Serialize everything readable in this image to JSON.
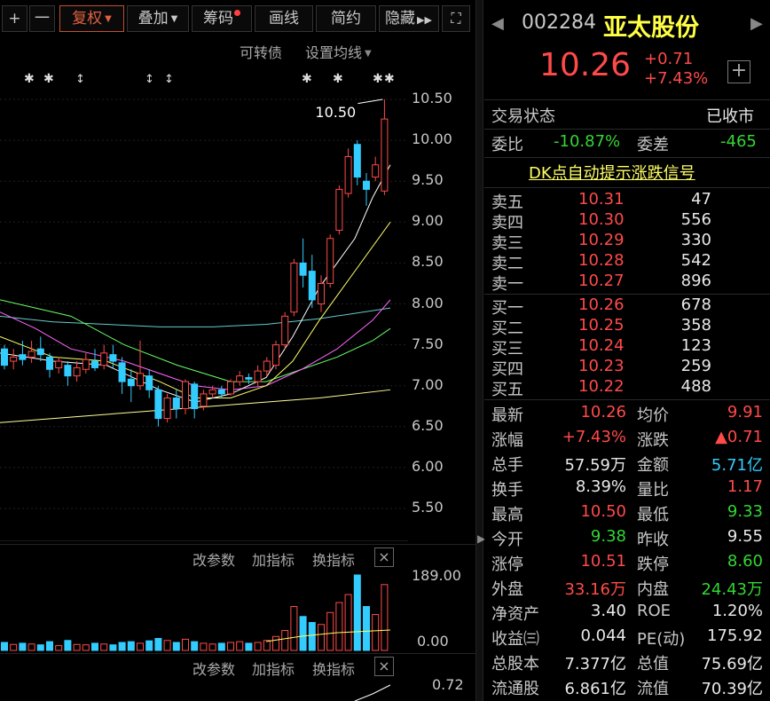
{
  "toolbar": {
    "plus": "+",
    "minus": "一",
    "fuquan": "复权",
    "diejia": "叠加",
    "chouma": "筹码",
    "huaxian": "画线",
    "jianyue": "简约",
    "yincang": "隐藏",
    "fullscreen_icon": "⛶"
  },
  "chart_header": {
    "kezhuanzhai": "可转债",
    "shezhi_junxian": "设置均线"
  },
  "price_axis": {
    "ticks": [
      "10.50",
      "10.00",
      "9.50",
      "9.00",
      "8.50",
      "8.00",
      "7.50",
      "7.00",
      "6.50",
      "6.00",
      "5.50"
    ],
    "high_marker": "10.50"
  },
  "volume_panel": {
    "gaicanshu": "改参数",
    "jiazhibiao": "加指标",
    "huanzhibiao": "换指标",
    "close": "×",
    "top_tick": "189.00",
    "bottom_tick": "0.00"
  },
  "indicator_panel": {
    "gaicanshu": "改参数",
    "jiazhibiao": "加指标",
    "huanzhibiao": "换指标",
    "close": "×",
    "top_tick": "0.72"
  },
  "quote": {
    "code": "002284",
    "name": "亚太股份",
    "price": "10.26",
    "change": "+0.71",
    "change_pct": "+7.43%",
    "jiaoyi_label": "交易状态",
    "jiaoyi_value": "已收市",
    "weibi_label": "委比",
    "weibi_value": "-10.87%",
    "weicha_label": "委差",
    "weicha_value": "-465",
    "dk_link": "DK点自动提示涨跌信号"
  },
  "orderbook": {
    "asks": [
      {
        "label": "卖五",
        "price": "10.31",
        "vol": "47"
      },
      {
        "label": "卖四",
        "price": "10.30",
        "vol": "556"
      },
      {
        "label": "卖三",
        "price": "10.29",
        "vol": "330"
      },
      {
        "label": "卖二",
        "price": "10.28",
        "vol": "542"
      },
      {
        "label": "卖一",
        "price": "10.27",
        "vol": "896"
      }
    ],
    "bids": [
      {
        "label": "买一",
        "price": "10.26",
        "vol": "678"
      },
      {
        "label": "买二",
        "price": "10.25",
        "vol": "358"
      },
      {
        "label": "买三",
        "price": "10.24",
        "vol": "123"
      },
      {
        "label": "买四",
        "price": "10.23",
        "vol": "259"
      },
      {
        "label": "买五",
        "price": "10.22",
        "vol": "488"
      }
    ]
  },
  "stats": [
    {
      "l1": "最新",
      "v1": "10.26",
      "c1": "red",
      "l2": "均价",
      "v2": "9.91",
      "c2": "red"
    },
    {
      "l1": "涨幅",
      "v1": "+7.43%",
      "c1": "red",
      "l2": "涨跌",
      "v2": "▲0.71",
      "c2": "red"
    },
    {
      "l1": "总手",
      "v1": "57.59万",
      "c1": "white",
      "l2": "金额",
      "v2": "5.71亿",
      "c2": "cyan"
    },
    {
      "l1": "换手",
      "v1": "8.39%",
      "c1": "white",
      "l2": "量比",
      "v2": "1.17",
      "c2": "red"
    },
    {
      "l1": "最高",
      "v1": "10.50",
      "c1": "red",
      "l2": "最低",
      "v2": "9.33",
      "c2": "green"
    },
    {
      "l1": "今开",
      "v1": "9.38",
      "c1": "green",
      "l2": "昨收",
      "v2": "9.55",
      "c2": "white"
    },
    {
      "l1": "涨停",
      "v1": "10.51",
      "c1": "red",
      "l2": "跌停",
      "v2": "8.60",
      "c2": "green"
    },
    {
      "l1": "外盘",
      "v1": "33.16万",
      "c1": "red",
      "l2": "内盘",
      "v2": "24.43万",
      "c2": "green"
    },
    {
      "l1": "净资产",
      "v1": "3.40",
      "c1": "white",
      "l2": "ROE",
      "v2": "1.20%",
      "c2": "white"
    },
    {
      "l1": "收益㈢",
      "v1": "0.044",
      "c1": "white",
      "l2": "PE(动)",
      "v2": "175.92",
      "c2": "white"
    },
    {
      "l1": "总股本",
      "v1": "7.377亿",
      "c1": "white",
      "l2": "总值",
      "v2": "75.69亿",
      "c2": "white"
    },
    {
      "l1": "流通股",
      "v1": "6.861亿",
      "c1": "white",
      "l2": "流值",
      "v2": "70.39亿",
      "c2": "white"
    }
  ],
  "colors": {
    "up": "#ff4a4a",
    "down": "#33d633",
    "down_candle": "#33ccff",
    "ma5": "#ffffff",
    "ma10": "#ffff66",
    "ma20": "#ff66ff",
    "ma30": "#66ff66",
    "ma60": "#66cccc",
    "ma120": "#ffff99"
  },
  "chart_data": {
    "type": "candlestick",
    "ylim": [
      5.2,
      10.7
    ],
    "candles": [
      {
        "o": 7.45,
        "c": 7.25,
        "h": 7.5,
        "l": 7.2
      },
      {
        "o": 7.3,
        "c": 7.35,
        "h": 7.45,
        "l": 7.2
      },
      {
        "o": 7.38,
        "c": 7.32,
        "h": 7.55,
        "l": 7.25
      },
      {
        "o": 7.35,
        "c": 7.42,
        "h": 7.55,
        "l": 7.28
      },
      {
        "o": 7.45,
        "c": 7.38,
        "h": 7.6,
        "l": 7.3
      },
      {
        "o": 7.35,
        "c": 7.2,
        "h": 7.4,
        "l": 7.1
      },
      {
        "o": 7.22,
        "c": 7.3,
        "h": 7.35,
        "l": 7.15
      },
      {
        "o": 7.25,
        "c": 7.12,
        "h": 7.3,
        "l": 7.0
      },
      {
        "o": 7.12,
        "c": 7.22,
        "h": 7.3,
        "l": 7.05
      },
      {
        "o": 7.2,
        "c": 7.32,
        "h": 7.4,
        "l": 7.15
      },
      {
        "o": 7.3,
        "c": 7.22,
        "h": 7.45,
        "l": 7.18
      },
      {
        "o": 7.25,
        "c": 7.4,
        "h": 7.5,
        "l": 7.2
      },
      {
        "o": 7.38,
        "c": 7.3,
        "h": 7.5,
        "l": 7.22
      },
      {
        "o": 7.28,
        "c": 7.05,
        "h": 7.35,
        "l": 6.9
      },
      {
        "o": 7.08,
        "c": 7.0,
        "h": 7.2,
        "l": 6.8
      },
      {
        "o": 7.0,
        "c": 7.15,
        "h": 7.55,
        "l": 6.95
      },
      {
        "o": 7.12,
        "c": 6.95,
        "h": 7.2,
        "l": 6.85
      },
      {
        "o": 6.95,
        "c": 6.6,
        "h": 7.0,
        "l": 6.5
      },
      {
        "o": 6.6,
        "c": 6.85,
        "h": 6.9,
        "l": 6.55
      },
      {
        "o": 6.85,
        "c": 6.72,
        "h": 6.95,
        "l": 6.6
      },
      {
        "o": 6.72,
        "c": 7.05,
        "h": 7.08,
        "l": 6.65
      },
      {
        "o": 7.02,
        "c": 6.72,
        "h": 7.05,
        "l": 6.6
      },
      {
        "o": 6.75,
        "c": 6.9,
        "h": 6.95,
        "l": 6.7
      },
      {
        "o": 6.9,
        "c": 6.95,
        "h": 7.0,
        "l": 6.85
      },
      {
        "o": 6.95,
        "c": 6.9,
        "h": 7.0,
        "l": 6.85
      },
      {
        "o": 6.9,
        "c": 7.05,
        "h": 7.08,
        "l": 6.88
      },
      {
        "o": 7.05,
        "c": 7.12,
        "h": 7.18,
        "l": 7.0
      },
      {
        "o": 7.1,
        "c": 7.08,
        "h": 7.15,
        "l": 7.02
      },
      {
        "o": 7.05,
        "c": 7.18,
        "h": 7.25,
        "l": 7.0
      },
      {
        "o": 7.18,
        "c": 7.3,
        "h": 7.35,
        "l": 7.12
      },
      {
        "o": 7.25,
        "c": 7.5,
        "h": 7.55,
        "l": 7.2
      },
      {
        "o": 7.5,
        "c": 7.85,
        "h": 7.9,
        "l": 7.45
      },
      {
        "o": 7.9,
        "c": 8.5,
        "h": 8.55,
        "l": 7.85
      },
      {
        "o": 8.5,
        "c": 8.35,
        "h": 8.8,
        "l": 8.2
      },
      {
        "o": 8.4,
        "c": 8.05,
        "h": 8.6,
        "l": 7.95
      },
      {
        "o": 8.0,
        "c": 8.25,
        "h": 8.35,
        "l": 7.9
      },
      {
        "o": 8.25,
        "c": 8.8,
        "h": 8.85,
        "l": 8.2
      },
      {
        "o": 8.9,
        "c": 9.4,
        "h": 9.45,
        "l": 8.85
      },
      {
        "o": 9.35,
        "c": 9.8,
        "h": 9.9,
        "l": 9.3
      },
      {
        "o": 9.95,
        "c": 9.55,
        "h": 10.0,
        "l": 9.45
      },
      {
        "o": 9.5,
        "c": 9.4,
        "h": 9.6,
        "l": 9.2
      },
      {
        "o": 9.55,
        "c": 9.7,
        "h": 9.8,
        "l": 9.5
      },
      {
        "o": 9.38,
        "c": 10.26,
        "h": 10.5,
        "l": 9.33
      }
    ],
    "volumes": [
      20,
      15,
      18,
      16,
      14,
      22,
      12,
      25,
      15,
      14,
      18,
      16,
      14,
      20,
      22,
      18,
      24,
      30,
      25,
      20,
      28,
      22,
      18,
      16,
      18,
      20,
      22,
      18,
      20,
      25,
      35,
      50,
      110,
      85,
      70,
      65,
      95,
      120,
      140,
      189,
      110,
      90,
      165
    ]
  }
}
